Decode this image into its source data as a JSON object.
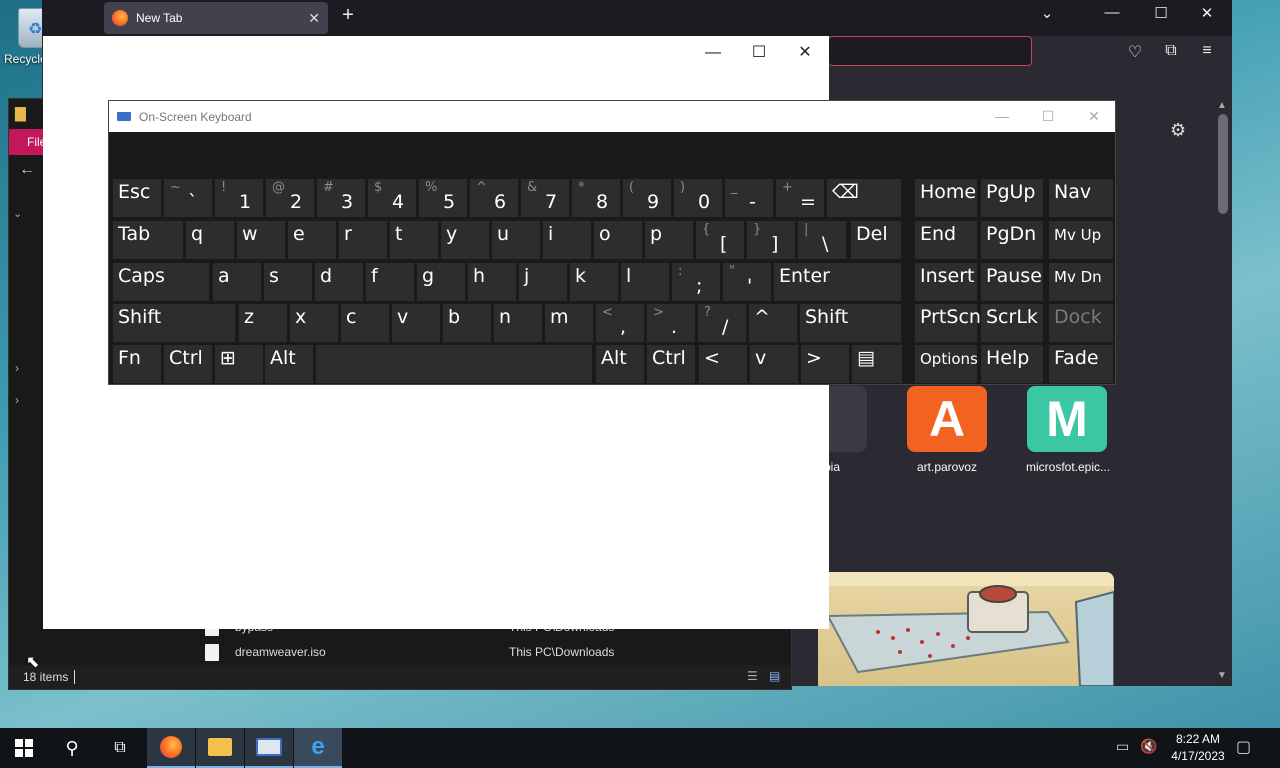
{
  "desktop": {
    "recycle_label": "Recycle"
  },
  "firefox": {
    "tab_title": "New Tab",
    "close_glyph": "✕",
    "new_tab_glyph": "+",
    "tiles": [
      {
        "label": "mbia",
        "letter": ""
      },
      {
        "label": "art.parovoz",
        "letter": "A",
        "color": "#f26322"
      },
      {
        "label": "microsfot.epic...",
        "letter": "M",
        "color": "#3cc7a4"
      }
    ]
  },
  "explorer": {
    "ribbon_label": "File",
    "rows": [
      {
        "name": "bypass",
        "path": "This PC\\Downloads"
      },
      {
        "name": "dreamweaver.iso",
        "path": "This PC\\Downloads"
      }
    ],
    "status": "18 items"
  },
  "osk": {
    "title": "On-Screen Keyboard",
    "rows": {
      "r1": [
        {
          "m": "Esc"
        },
        {
          "s": "~",
          "l": "`"
        },
        {
          "s": "!",
          "l": "1"
        },
        {
          "s": "@",
          "l": "2"
        },
        {
          "s": "#",
          "l": "3"
        },
        {
          "s": "$",
          "l": "4"
        },
        {
          "s": "%",
          "l": "5"
        },
        {
          "s": "^",
          "l": "6"
        },
        {
          "s": "&",
          "l": "7"
        },
        {
          "s": "*",
          "l": "8"
        },
        {
          "s": "(",
          "l": "9"
        },
        {
          "s": ")",
          "l": "0"
        },
        {
          "s": "_",
          "l": "-"
        },
        {
          "s": "+",
          "l": "="
        },
        {
          "m": "⌫"
        },
        {
          "m": "Home"
        },
        {
          "m": "PgUp"
        },
        {
          "m": "Nav"
        }
      ],
      "r2": [
        {
          "m": "Tab"
        },
        {
          "m": "q"
        },
        {
          "m": "w"
        },
        {
          "m": "e"
        },
        {
          "m": "r"
        },
        {
          "m": "t"
        },
        {
          "m": "y"
        },
        {
          "m": "u"
        },
        {
          "m": "i"
        },
        {
          "m": "o"
        },
        {
          "m": "p"
        },
        {
          "s": "{",
          "l": "["
        },
        {
          "s": "}",
          "l": "]"
        },
        {
          "s": "|",
          "l": "\\"
        },
        {
          "m": "Del"
        },
        {
          "m": "End"
        },
        {
          "m": "PgDn"
        },
        {
          "m": "Mv Up"
        }
      ],
      "r3": [
        {
          "m": "Caps"
        },
        {
          "m": "a"
        },
        {
          "m": "s"
        },
        {
          "m": "d"
        },
        {
          "m": "f"
        },
        {
          "m": "g"
        },
        {
          "m": "h"
        },
        {
          "m": "j"
        },
        {
          "m": "k"
        },
        {
          "m": "l"
        },
        {
          "s": ":",
          "l": ";"
        },
        {
          "s": "\"",
          "l": "'"
        },
        {
          "m": "Enter"
        },
        {
          "m": "Insert"
        },
        {
          "m": "Pause"
        },
        {
          "m": "Mv Dn"
        }
      ],
      "r4": [
        {
          "m": "Shift"
        },
        {
          "m": "z"
        },
        {
          "m": "x"
        },
        {
          "m": "c"
        },
        {
          "m": "v"
        },
        {
          "m": "b"
        },
        {
          "m": "n"
        },
        {
          "m": "m"
        },
        {
          "s": "<",
          "l": ","
        },
        {
          "s": ">",
          "l": "."
        },
        {
          "s": "?",
          "l": "/"
        },
        {
          "m": "^"
        },
        {
          "m": "Shift"
        },
        {
          "m": "PrtScn"
        },
        {
          "m": "ScrLk"
        },
        {
          "m": "Dock"
        }
      ],
      "r5": [
        {
          "m": "Fn"
        },
        {
          "m": "Ctrl"
        },
        {
          "m": "⊞"
        },
        {
          "m": "Alt"
        },
        {
          "m": ""
        },
        {
          "m": "Alt"
        },
        {
          "m": "Ctrl"
        },
        {
          "m": "<"
        },
        {
          "m": "v"
        },
        {
          "m": ">"
        },
        {
          "m": "▤"
        },
        {
          "m": "Options"
        },
        {
          "m": "Help"
        },
        {
          "m": "Fade"
        }
      ]
    }
  },
  "taskbar": {
    "time": "8:22 AM",
    "date": "4/17/2023"
  }
}
